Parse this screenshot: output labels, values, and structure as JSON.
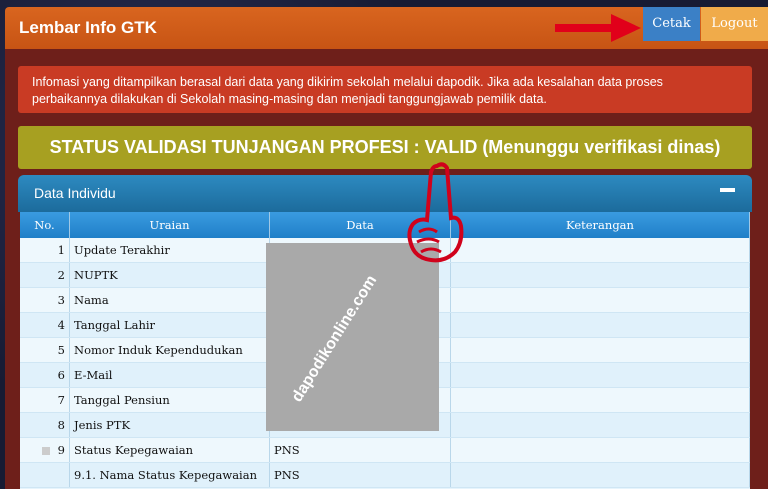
{
  "header": {
    "title": "Lembar Info GTK",
    "cetak_label": "Cetak",
    "logout_label": "Logout"
  },
  "alert": {
    "text": "Infomasi yang ditampilkan berasal dari data yang dikirim sekolah melalui dapodik. Jika ada kesalahan data proses perbaikannya dilakukan di Sekolah masing-masing dan menjadi tanggungjawab pemilik data."
  },
  "status": {
    "text": "STATUS VALIDASI TUNJANGAN PROFESI : VALID (Menunggu verifikasi dinas)"
  },
  "panel": {
    "title": "Data Individu"
  },
  "table": {
    "headers": [
      "No.",
      "Uraian",
      "Data",
      "Keterangan"
    ],
    "rows": [
      {
        "no": "1",
        "uraian": "Update Terakhir",
        "data": "",
        "ket": ""
      },
      {
        "no": "2",
        "uraian": "NUPTK",
        "data": "",
        "ket": ""
      },
      {
        "no": "3",
        "uraian": "Nama",
        "data": "",
        "ket": ""
      },
      {
        "no": "4",
        "uraian": "Tanggal Lahir",
        "data": "",
        "ket": ""
      },
      {
        "no": "5",
        "uraian": "Nomor Induk Kependudukan",
        "data": "",
        "ket": ""
      },
      {
        "no": "6",
        "uraian": "E-Mail",
        "data": "",
        "ket": ""
      },
      {
        "no": "7",
        "uraian": "Tanggal Pensiun",
        "data": "",
        "ket": ""
      },
      {
        "no": "8",
        "uraian": "Jenis PTK",
        "data": "",
        "ket": ""
      },
      {
        "no": "9",
        "uraian": "Status Kepegawaian",
        "data": "PNS",
        "ket": ""
      },
      {
        "no": "",
        "uraian": "9.1. Nama Status Kepegawaian",
        "data": "PNS",
        "ket": ""
      }
    ]
  },
  "watermark": {
    "text": "dapodikonline.com"
  }
}
